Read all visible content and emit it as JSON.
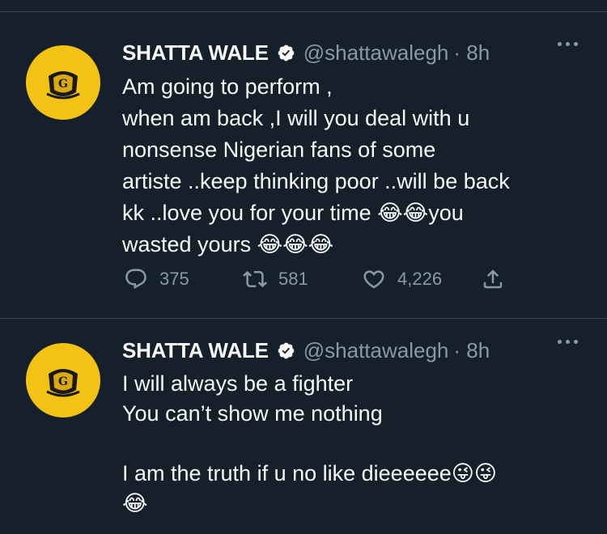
{
  "tweets": [
    {
      "author": {
        "name": "SHATTA WALE",
        "handle": "@shattawalegh",
        "time": "· 8h",
        "verified": true
      },
      "text": "Am going to perform ,\nwhen am back ,I will you deal with u\nnonsense Nigerian fans of some\nartiste ..keep thinking poor ..will be back\nkk ..love you for your time 😂😂you\nwasted yours 😂😂😂",
      "actions": {
        "replies": "375",
        "retweets": "581",
        "likes": "4,226"
      }
    },
    {
      "author": {
        "name": "SHATTA WALE",
        "handle": "@shattawalegh",
        "time": "· 8h",
        "verified": true
      },
      "text": "I will always be a fighter\nYou can’t show me nothing\n\nI am the truth if u no like dieeeeee😜😜\n😂"
    }
  ],
  "colors": {
    "background": "#15202b",
    "text": "#f7f9f9",
    "secondary": "#8b98a5",
    "divider": "#38444d",
    "avatar_bg": "#f2c314"
  },
  "icons": [
    "verified-badge-icon",
    "more-icon",
    "reply-icon",
    "retweet-icon",
    "like-icon",
    "share-icon"
  ]
}
